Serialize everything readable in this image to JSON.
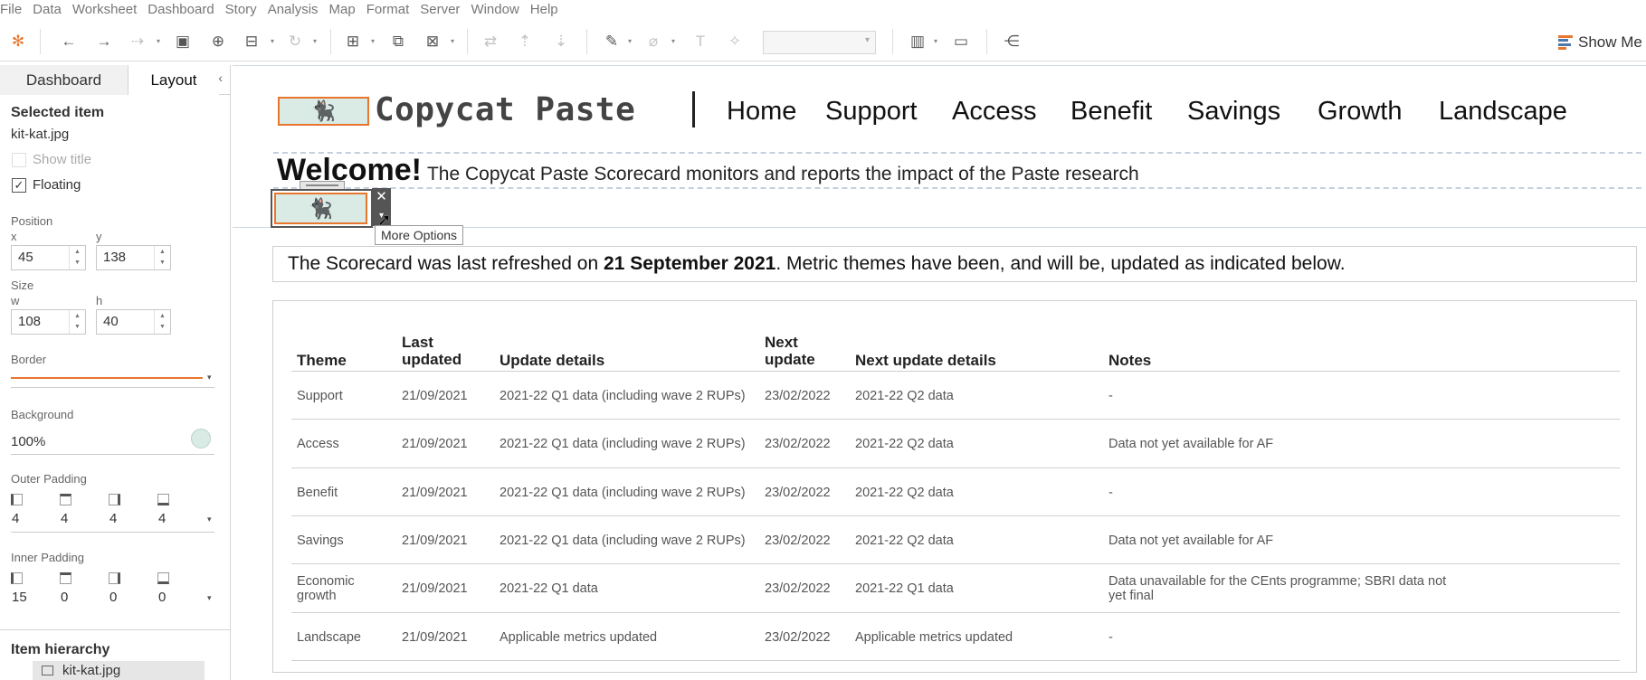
{
  "menu": [
    "File",
    "Data",
    "Worksheet",
    "Dashboard",
    "Story",
    "Analysis",
    "Map",
    "Format",
    "Server",
    "Window",
    "Help"
  ],
  "toolbar": {
    "show_me": "Show Me"
  },
  "left_panel": {
    "tabs": [
      "Dashboard",
      "Layout"
    ],
    "selected_item_heading": "Selected item",
    "selected_item_name": "kit-kat.jpg",
    "show_title_label": "Show title",
    "floating_label": "Floating",
    "position_label": "Position",
    "x_label": "x",
    "x_value": "45",
    "y_label": "y",
    "y_value": "138",
    "size_label": "Size",
    "w_label": "w",
    "w_value": "108",
    "h_label": "h",
    "h_value": "40",
    "border_label": "Border",
    "background_label": "Background",
    "background_value": "100%",
    "outer_padding_label": "Outer Padding",
    "outer_padding": [
      "4",
      "4",
      "4",
      "4"
    ],
    "inner_padding_label": "Inner Padding",
    "inner_padding": [
      "15",
      "0",
      "0",
      "0"
    ],
    "item_hierarchy_label": "Item hierarchy",
    "hierarchy_item": "kit-kat.jpg"
  },
  "header": {
    "brand": "Copycat Paste",
    "nav": [
      "Home",
      "Support",
      "Access",
      "Benefit",
      "Savings",
      "Growth",
      "Landscape"
    ],
    "welcome_bold": "Welcome!",
    "welcome_text": "The Copycat Paste Scorecard monitors and reports the impact of the Paste research",
    "close_symbol": "✕",
    "more_symbol": "▾",
    "tooltip": "More Options"
  },
  "refresh": {
    "prefix": "The Scorecard was last refreshed on ",
    "date": "21 September 2021",
    "suffix": ". Metric themes have been, and will be, updated as indicated below."
  },
  "table": {
    "headers": [
      "Theme",
      "Last updated",
      "Update details",
      "Next update",
      "Next update details",
      "Notes"
    ],
    "rows": [
      [
        "Support",
        "21/09/2021",
        "2021-22 Q1 data (including wave 2 RUPs)",
        "23/02/2022",
        "2021-22 Q2 data",
        "-"
      ],
      [
        "Access",
        "21/09/2021",
        "2021-22 Q1 data (including wave 2 RUPs)",
        "23/02/2022",
        "2021-22 Q2 data",
        "Data not yet available for AF"
      ],
      [
        "Benefit",
        "21/09/2021",
        "2021-22 Q1 data (including wave 2 RUPs)",
        "23/02/2022",
        "2021-22 Q2 data",
        "-"
      ],
      [
        "Savings",
        "21/09/2021",
        "2021-22 Q1 data (including wave 2 RUPs)",
        "23/02/2022",
        "2021-22 Q2 data",
        "Data not yet available for AF"
      ],
      [
        "Economic growth",
        "21/09/2021",
        "2021-22 Q1 data",
        "23/02/2022",
        "2021-22 Q1 data",
        "Data unavailable for the CEnts programme; SBRI data not yet final"
      ],
      [
        "Landscape",
        "21/09/2021",
        "Applicable metrics updated",
        "23/02/2022",
        "Applicable metrics updated",
        "-"
      ]
    ]
  },
  "colors": {
    "accent_orange": "#e8762d",
    "logo_bg": "#d9ebe4"
  }
}
